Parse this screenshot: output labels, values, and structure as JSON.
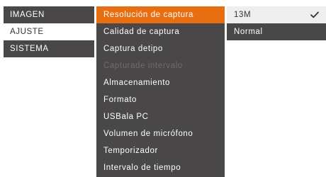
{
  "menu": {
    "categories": [
      {
        "label": "IMAGEN",
        "state": "normal"
      },
      {
        "label": "AJUSTE",
        "state": "selected"
      },
      {
        "label": "SISTEMA",
        "state": "normal"
      }
    ],
    "settings": [
      {
        "label": "Resolución de captura",
        "state": "active"
      },
      {
        "label": "Calidad de captura",
        "state": "normal"
      },
      {
        "label": "Captura detipo",
        "state": "normal"
      },
      {
        "label": "Capturade intervalo",
        "state": "disabled"
      },
      {
        "label": "Almacenamiento",
        "state": "normal"
      },
      {
        "label": "Formato",
        "state": "normal"
      },
      {
        "label": "USBala PC",
        "state": "normal"
      },
      {
        "label": "Volumen de micrófono",
        "state": "normal"
      },
      {
        "label": "Temporizador",
        "state": "normal"
      },
      {
        "label": "Intervalo de tiempo",
        "state": "normal"
      }
    ],
    "options": [
      {
        "label": "13M",
        "checked": true
      },
      {
        "label": "Normal",
        "checked": false
      }
    ]
  },
  "colors": {
    "panel": "#4a4748",
    "accent": "#e86e12",
    "selected_bg": "#ffffff",
    "disabled_text": "#6f6c6d"
  },
  "icons": {
    "checkmark": "check-icon"
  }
}
